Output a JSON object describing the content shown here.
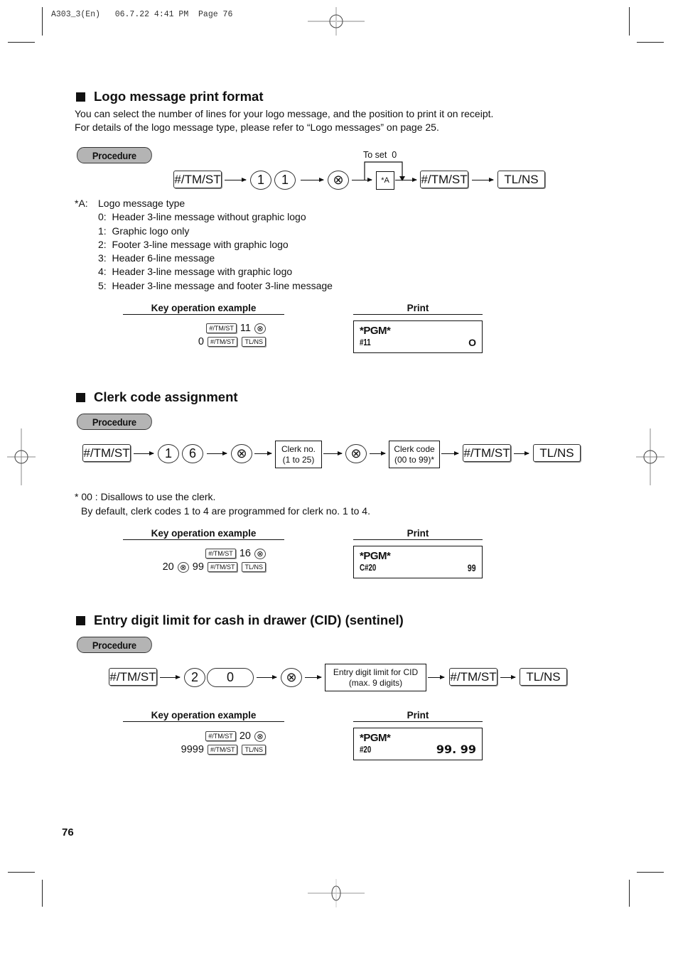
{
  "slug": "A303_3(En)   06.7.22 4:41 PM  Page 76",
  "page_number": "76",
  "sections": [
    {
      "title": "Logo message print format",
      "intro": [
        "You can select the number of lines for your logo message, and the position to print it on receipt.",
        "For details of the logo message type, please refer to “Logo messages” on page 25."
      ],
      "procedure_label": "Procedure",
      "flow": {
        "key1": "#/TM/ST",
        "digits": [
          "1",
          "1"
        ],
        "x_key": "⊗",
        "set_label": "To set  0",
        "input_box": "*A",
        "key2": "#/TM/ST",
        "key3": "TL/NS"
      },
      "legend": {
        "heading_key": "*A:",
        "heading_text": "Logo message type",
        "items": [
          "0:  Header 3-line message without graphic logo",
          "1:  Graphic logo only",
          "2:  Footer 3-line message with graphic logo",
          "3:  Header 6-line message",
          "4:  Header 3-line message with graphic logo",
          "5:  Header 3-line message and footer 3-line message"
        ]
      },
      "example": {
        "key_op_header": "Key operation example",
        "print_header": "Print",
        "line1": {
          "key": "#/TM/ST",
          "num": "11",
          "x": "⊗"
        },
        "line2": {
          "num": "0",
          "key1": "#/TM/ST",
          "key2": "TL/NS"
        },
        "receipt": {
          "pgm": "*PGM*",
          "code": "#11",
          "value": "O"
        }
      }
    },
    {
      "title": "Clerk code assignment",
      "procedure_label": "Procedure",
      "flow": {
        "key1": "#/TM/ST",
        "digits": [
          "1",
          "6"
        ],
        "x_key": "⊗",
        "box1_line1": "Clerk no.",
        "box1_line2": "(1 to 25)",
        "x_key2": "⊗",
        "box2_line1": "Clerk code",
        "box2_line2": "(00 to 99)*",
        "key2": "#/TM/ST",
        "key3": "TL/NS"
      },
      "notes": [
        "* 00 : Disallows to use the clerk.",
        "By default, clerk codes 1 to 4 are programmed for clerk no. 1 to 4."
      ],
      "example": {
        "key_op_header": "Key operation example",
        "print_header": "Print",
        "line1": {
          "key": "#/TM/ST",
          "num": "16",
          "x": "⊗"
        },
        "line2": {
          "num": "20",
          "x": "⊗",
          "num2": "99",
          "key1": "#/TM/ST",
          "key2": "TL/NS"
        },
        "receipt": {
          "pgm": "*PGM*",
          "code": "C#20",
          "value": "99"
        }
      }
    },
    {
      "title": "Entry digit limit for cash in drawer (CID) (sentinel)",
      "procedure_label": "Procedure",
      "flow": {
        "key1": "#/TM/ST",
        "digits": [
          "2",
          "0"
        ],
        "x_key": "⊗",
        "box_line1": "Entry digit limit for CID",
        "box_line2": "(max. 9 digits)",
        "key2": "#/TM/ST",
        "key3": "TL/NS"
      },
      "example": {
        "key_op_header": "Key operation example",
        "print_header": "Print",
        "line1": {
          "key": "#/TM/ST",
          "num": "20",
          "x": "⊗"
        },
        "line2": {
          "num": "9999",
          "key1": "#/TM/ST",
          "key2": "TL/NS"
        },
        "receipt": {
          "pgm": "*PGM*",
          "code": "#20",
          "value": "99. 99"
        }
      }
    }
  ]
}
